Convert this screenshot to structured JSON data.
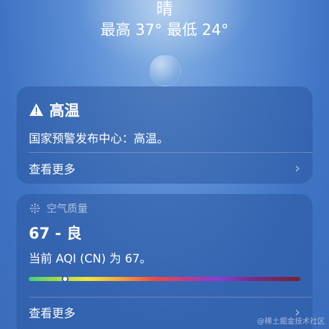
{
  "weather": {
    "condition": "晴",
    "high_low": "最高 37°  最低 24°"
  },
  "alert": {
    "title": "高温",
    "description": "国家预警发布中心：高温。",
    "more_label": "查看更多",
    "icon": "warning-triangle-icon"
  },
  "aqi": {
    "header": "空气质量",
    "value_label": "67 - 良",
    "value": 67,
    "scale_max": 500,
    "description": "当前 AQI (CN) 为 67。",
    "more_label": "查看更多",
    "icon": "haze-icon"
  },
  "watermark": "@稀土掘金技术社区"
}
